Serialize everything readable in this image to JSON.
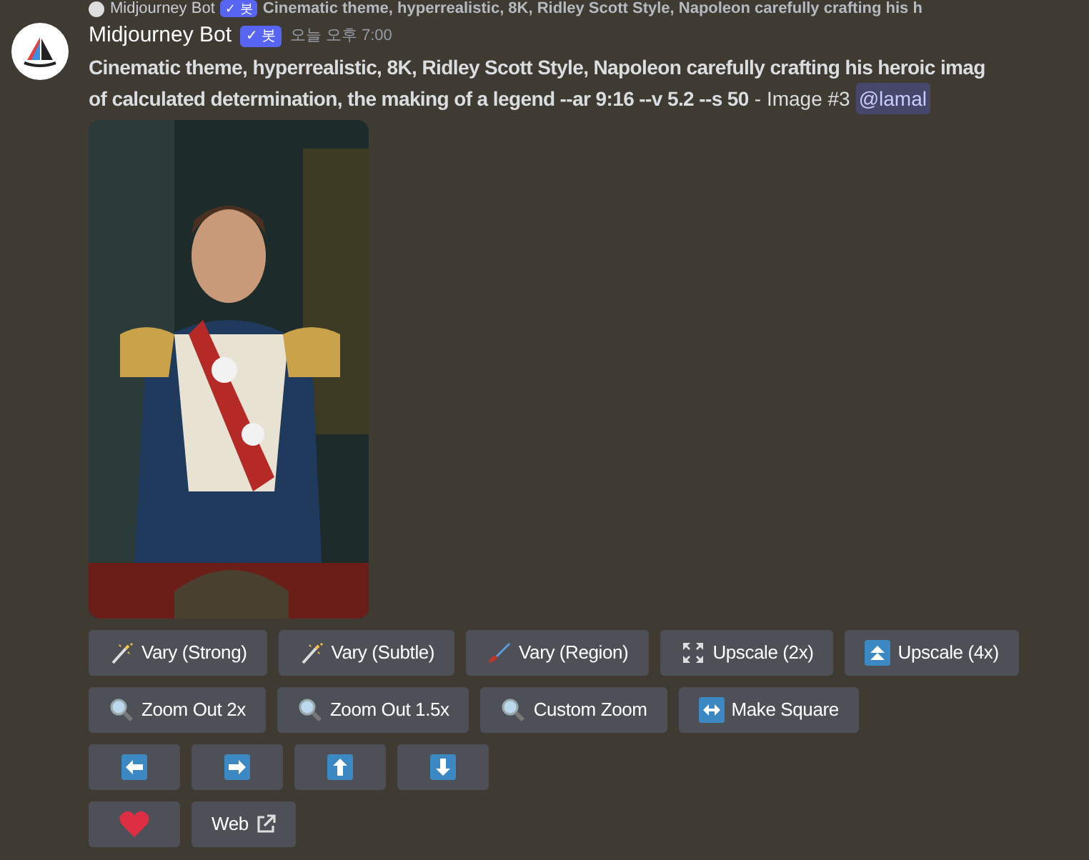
{
  "reply_preview": {
    "author": "Midjourney Bot",
    "badge": "✓ 봇",
    "text": "Cinematic theme, hyperrealistic, 8K, Ridley Scott Style, Napoleon carefully crafting his h"
  },
  "message": {
    "author": "Midjourney Bot",
    "badge": "✓ 봇",
    "timestamp": "오늘 오후 7:00",
    "lines": [
      "Cinematic theme, hyperrealistic, 8K, Ridley Scott Style, Napoleon carefully crafting his heroic imag",
      "of calculated determination, the making of a legend --ar 9:16 --v 5.2 --s 50"
    ],
    "suffix": "- Image #3",
    "mention": "@lamal"
  },
  "button_rows": [
    [
      {
        "kind": "wand",
        "label": "Vary (Strong)"
      },
      {
        "kind": "wand",
        "label": "Vary (Subtle)"
      },
      {
        "kind": "brush",
        "label": "Vary (Region)"
      },
      {
        "kind": "expand",
        "label": "Upscale (2x)"
      },
      {
        "kind": "up-double",
        "label": "Upscale (4x)"
      }
    ],
    [
      {
        "kind": "magnifier",
        "label": "Zoom Out 2x"
      },
      {
        "kind": "magnifier",
        "label": "Zoom Out 1.5x"
      },
      {
        "kind": "magnifier",
        "label": "Custom Zoom"
      },
      {
        "kind": "left-right",
        "label": "Make Square"
      }
    ],
    [
      {
        "kind": "left"
      },
      {
        "kind": "right"
      },
      {
        "kind": "up"
      },
      {
        "kind": "down"
      }
    ],
    [
      {
        "kind": "heart"
      },
      {
        "kind": "link",
        "label": "Web"
      }
    ]
  ]
}
